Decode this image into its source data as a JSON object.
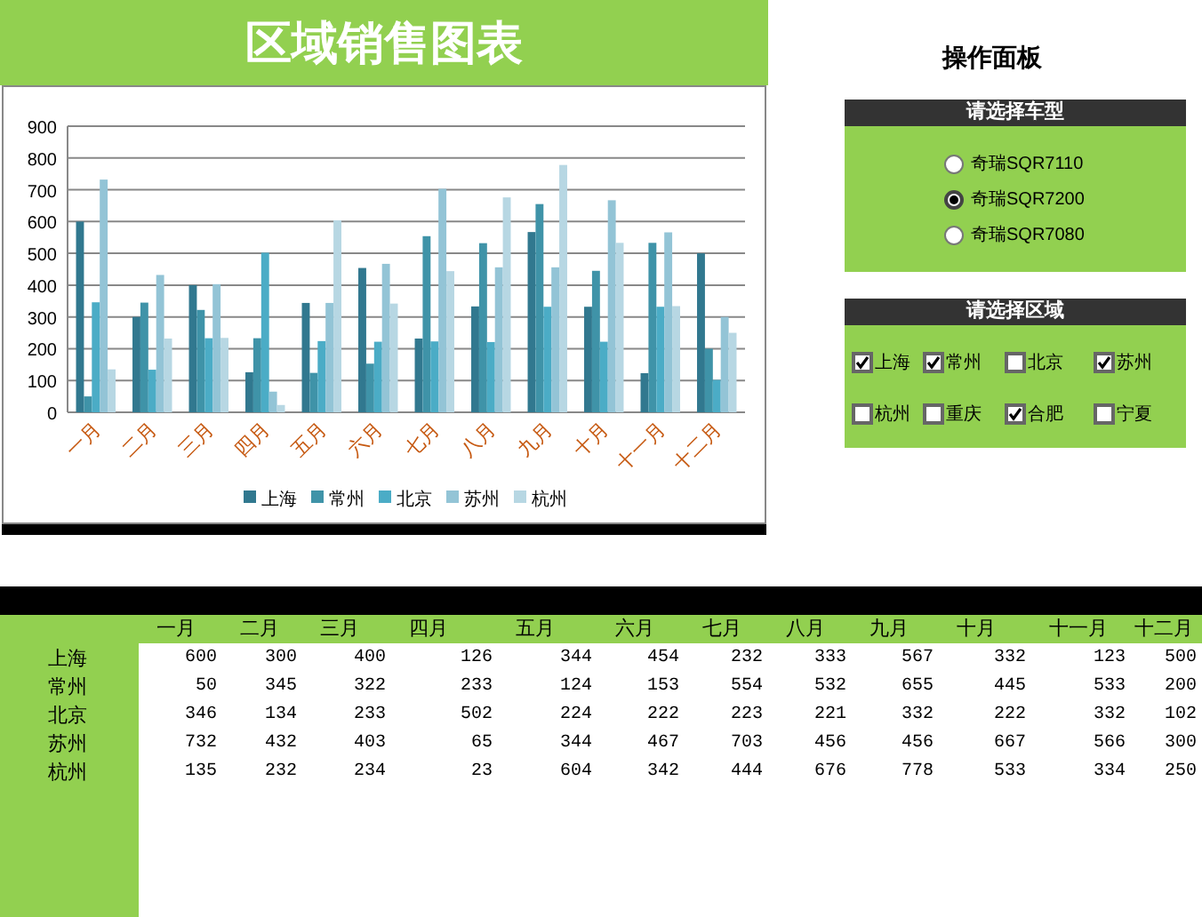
{
  "title": "区域销售图表",
  "chart": {
    "chart_data": {
      "type": "bar",
      "grid": true,
      "legend": true,
      "categories": [
        "一月",
        "二月",
        "三月",
        "四月",
        "五月",
        "六月",
        "七月",
        "八月",
        "九月",
        "十月",
        "十一月",
        "十二月"
      ],
      "ylim": [
        0,
        900
      ],
      "yticks": [
        0,
        100,
        200,
        300,
        400,
        500,
        600,
        700,
        800,
        900
      ],
      "series": [
        {
          "name": "上海",
          "color": "#31788f",
          "values": [
            600,
            300,
            400,
            126,
            344,
            454,
            232,
            333,
            567,
            332,
            123,
            500
          ]
        },
        {
          "name": "常州",
          "color": "#3f93a8",
          "values": [
            50,
            345,
            322,
            233,
            124,
            153,
            554,
            532,
            655,
            445,
            533,
            200
          ]
        },
        {
          "name": "北京",
          "color": "#4bacc6",
          "values": [
            346,
            134,
            233,
            502,
            224,
            222,
            223,
            221,
            332,
            222,
            332,
            102
          ]
        },
        {
          "name": "苏州",
          "color": "#93c4d6",
          "values": [
            732,
            432,
            403,
            65,
            344,
            467,
            703,
            456,
            456,
            667,
            566,
            300
          ]
        },
        {
          "name": "杭州",
          "color": "#b7d7e3",
          "values": [
            135,
            232,
            234,
            23,
            604,
            342,
            444,
            676,
            778,
            533,
            334,
            250
          ]
        }
      ]
    }
  },
  "control_panel": {
    "title": "操作面板",
    "car_model": {
      "header": "请选择车型",
      "options": [
        {
          "label": "奇瑞SQR7110",
          "selected": false
        },
        {
          "label": "奇瑞SQR7200",
          "selected": true
        },
        {
          "label": "奇瑞SQR7080",
          "selected": false
        }
      ]
    },
    "region": {
      "header": "请选择区域",
      "options": [
        {
          "label": "上海",
          "checked": true
        },
        {
          "label": "常州",
          "checked": true
        },
        {
          "label": "北京",
          "checked": false
        },
        {
          "label": "苏州",
          "checked": true
        },
        {
          "label": "杭州",
          "checked": false
        },
        {
          "label": "重庆",
          "checked": false
        },
        {
          "label": "合肥",
          "checked": true
        },
        {
          "label": "宁夏",
          "checked": false
        }
      ]
    }
  },
  "table": {
    "columns": [
      "一月",
      "二月",
      "三月",
      "四月",
      "五月",
      "六月",
      "七月",
      "八月",
      "九月",
      "十月",
      "十一月",
      "十二月"
    ],
    "rows": [
      {
        "label": "上海",
        "cells": [
          "600",
          "300",
          "400",
          "126",
          "344",
          "454",
          "232",
          "333",
          "567",
          "332",
          "123",
          "500"
        ]
      },
      {
        "label": "常州",
        "cells": [
          "50",
          "345",
          "322",
          "233",
          "124",
          "153",
          "554",
          "532",
          "655",
          "445",
          "533",
          "200"
        ]
      },
      {
        "label": "北京",
        "cells": [
          "346",
          "134",
          "233",
          "502",
          "224",
          "222",
          "223",
          "221",
          "332",
          "222",
          "332",
          "102"
        ]
      },
      {
        "label": "苏州",
        "cells": [
          "732",
          "432",
          "403",
          "65",
          "344",
          "467",
          "703",
          "456",
          "456",
          "667",
          "566",
          "300"
        ]
      },
      {
        "label": "杭州",
        "cells": [
          "135",
          "232",
          "234",
          "23",
          "604",
          "342",
          "444",
          "676",
          "778",
          "533",
          "334",
          "250"
        ]
      }
    ]
  }
}
